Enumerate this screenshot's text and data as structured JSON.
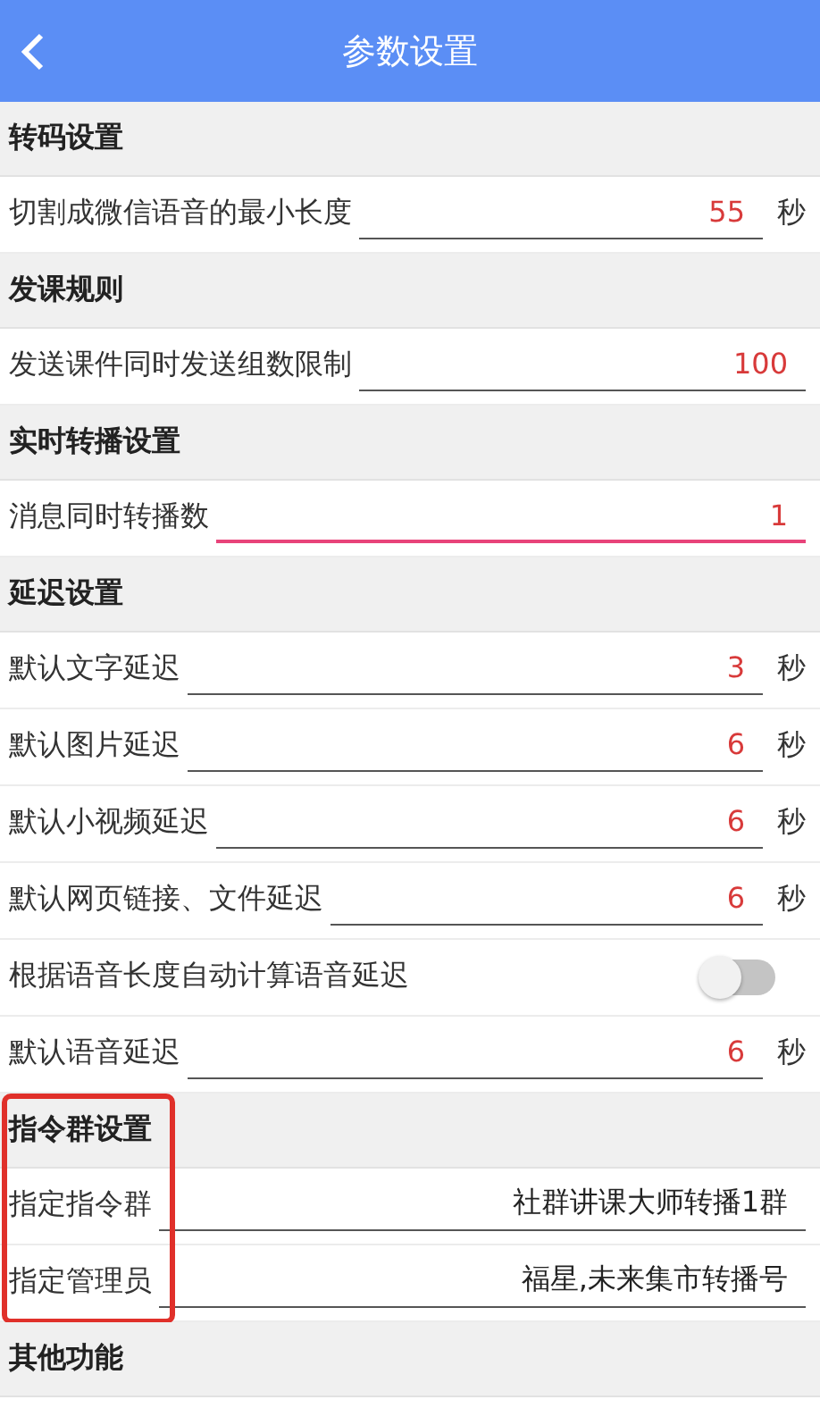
{
  "header": {
    "title": "参数设置"
  },
  "sections": [
    {
      "title": "转码设置",
      "highlighted": false,
      "rows": [
        {
          "kind": "number_input",
          "label": "切割成微信语音的最小长度",
          "value": "55",
          "unit": "秒",
          "focused": false
        }
      ]
    },
    {
      "title": "发课规则",
      "highlighted": false,
      "rows": [
        {
          "kind": "number_input",
          "label": "发送课件同时发送组数限制",
          "value": "100",
          "focused": false
        }
      ]
    },
    {
      "title": "实时转播设置",
      "highlighted": false,
      "rows": [
        {
          "kind": "number_input",
          "label": "消息同时转播数",
          "value": "1",
          "focused": true
        }
      ]
    },
    {
      "title": "延迟设置",
      "highlighted": false,
      "rows": [
        {
          "kind": "number_input",
          "label": "默认文字延迟",
          "value": "3",
          "unit": "秒",
          "focused": false
        },
        {
          "kind": "number_input",
          "label": "默认图片延迟",
          "value": "6",
          "unit": "秒",
          "focused": false
        },
        {
          "kind": "number_input",
          "label": "默认小视频延迟",
          "value": "6",
          "unit": "秒",
          "focused": false
        },
        {
          "kind": "number_input",
          "label": "默认网页链接、文件延迟",
          "value": "6",
          "unit": "秒",
          "focused": false
        },
        {
          "kind": "toggle",
          "label": "根据语音长度自动计算语音延迟",
          "on": false
        },
        {
          "kind": "number_input",
          "label": "默认语音延迟",
          "value": "6",
          "unit": "秒",
          "focused": false
        }
      ]
    },
    {
      "title": "指令群设置",
      "highlighted": true,
      "rows": [
        {
          "kind": "text_input",
          "label": "指定指令群",
          "value": "社群讲课大师转播1群",
          "focused": false
        },
        {
          "kind": "text_input",
          "label": "指定管理员",
          "value": "福星,未来集市转播号",
          "focused": false
        }
      ]
    },
    {
      "title": "其他功能",
      "highlighted": false
    }
  ]
}
